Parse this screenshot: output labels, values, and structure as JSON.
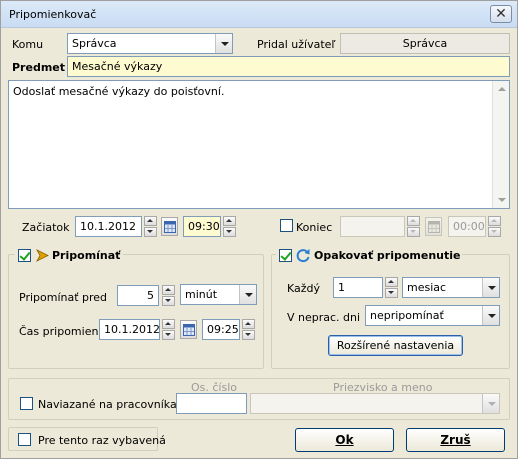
{
  "window": {
    "title": "Pripomienkovač",
    "close_glyph": "✕"
  },
  "form": {
    "komu_label": "Komu",
    "komu_value": "Správca",
    "pridal_label": "Pridal užívateľ",
    "pridal_value": "Správca",
    "predmet_label": "Predmet",
    "predmet_value": "Mesačné výkazy",
    "body_text": "Odoslať mesačné výkazy do poisťovní.",
    "zaciatok_label": "Začiatok",
    "zaciatok_date": "10.1.2012",
    "zaciatok_time": "09:30",
    "koniec_label": "Koniec",
    "koniec_date": "",
    "koniec_time": "00:00"
  },
  "pripominat": {
    "title": "Pripomínať",
    "pred_label": "Pripomínať pred",
    "pred_value": "5",
    "pred_unit": "minút",
    "cas_label": "Čas pripomienky",
    "cas_date": "10.1.2012",
    "cas_time": "09:25"
  },
  "opakovat": {
    "title": "Opakovať pripomenutie",
    "kazdy_label": "Každý",
    "kazdy_value": "1",
    "kazdy_unit": "mesiac",
    "neprac_label": "V neprac. dni",
    "neprac_value": "nepripomínať",
    "advanced_button": "Rozšírené nastavenia"
  },
  "pracovnik": {
    "os_cislo_header": "Os. číslo",
    "priezvisko_header": "Priezvisko a meno",
    "naviazane_label": "Naviazané na pracovníka:",
    "os_cislo_value": "",
    "priezvisko_value": ""
  },
  "footer": {
    "pre_tento_raz_label": "Pre tento raz vybavená",
    "ok_label": "Ok",
    "zrus_label": "Zruš"
  },
  "checks": {
    "koniec": false,
    "pripominat": true,
    "opakovat": true,
    "naviazane": false,
    "pre_tento_raz": false
  },
  "icons": {
    "pripominat_icon": "arrow-right-icon",
    "opakovat_icon": "refresh-icon",
    "calendar_icon": "calendar-icon"
  },
  "colors": {
    "highlight_field": "#fffbd0",
    "check_mark": "#21a121",
    "refresh_icon": "#2a7fd4",
    "arrow_icon": "#e0a000"
  }
}
